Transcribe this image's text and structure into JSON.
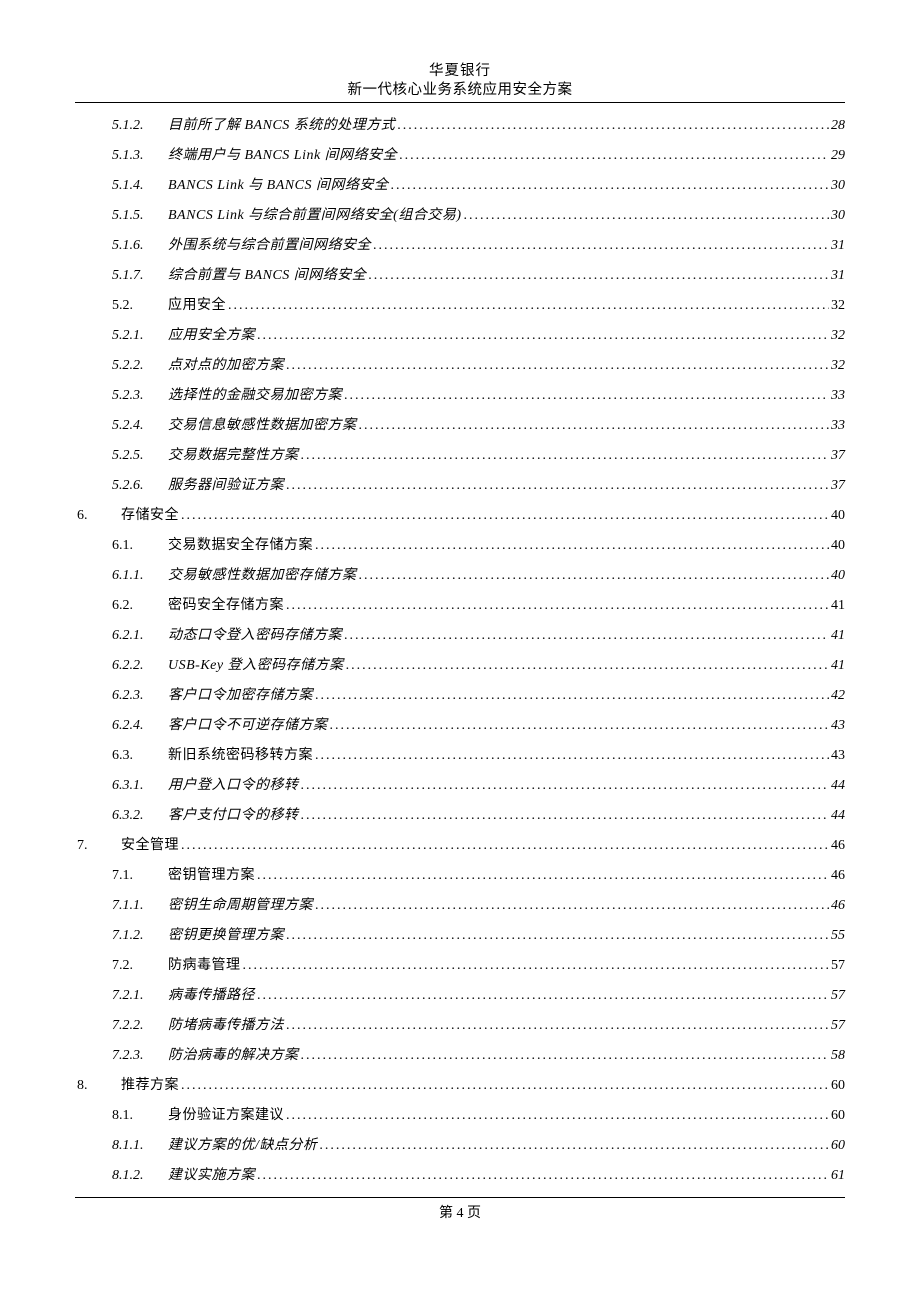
{
  "header": {
    "line1": "华夏银行",
    "line2": "新一代核心业务系统应用安全方案"
  },
  "toc": [
    {
      "level": "subsub",
      "num": "5.1.2.",
      "title": "目前所了解 BANCS 系统的处理方式",
      "page": "28"
    },
    {
      "level": "subsub",
      "num": "5.1.3.",
      "title": "终端用户与 BANCS Link 间网络安全",
      "page": "29"
    },
    {
      "level": "subsub",
      "num": "5.1.4.",
      "title": "BANCS Link 与 BANCS 间网络安全",
      "page": "30"
    },
    {
      "level": "subsub",
      "num": "5.1.5.",
      "title": "BANCS Link 与综合前置间网络安全(组合交易)",
      "page": "30"
    },
    {
      "level": "subsub",
      "num": "5.1.6.",
      "title": "外围系统与综合前置间网络安全",
      "page": "31"
    },
    {
      "level": "subsub",
      "num": "5.1.7.",
      "title": "综合前置与 BANCS 间网络安全",
      "page": "31"
    },
    {
      "level": "sub",
      "num": "5.2.",
      "title": "应用安全",
      "page": "32"
    },
    {
      "level": "subsub",
      "num": "5.2.1.",
      "title": "应用安全方案",
      "page": "32"
    },
    {
      "level": "subsub",
      "num": "5.2.2.",
      "title": "点对点的加密方案",
      "page": "32"
    },
    {
      "level": "subsub",
      "num": "5.2.3.",
      "title": "选择性的金融交易加密方案",
      "page": "33"
    },
    {
      "level": "subsub",
      "num": "5.2.4.",
      "title": "交易信息敏感性数据加密方案",
      "page": "33"
    },
    {
      "level": "subsub",
      "num": "5.2.5.",
      "title": "交易数据完整性方案",
      "page": "37"
    },
    {
      "level": "subsub",
      "num": "5.2.6.",
      "title": "服务器间验证方案",
      "page": "37"
    },
    {
      "level": "main",
      "num": "6.",
      "title": "存储安全",
      "page": "40"
    },
    {
      "level": "sub",
      "num": "6.1.",
      "title": "交易数据安全存储方案",
      "page": "40"
    },
    {
      "level": "subsub",
      "num": "6.1.1.",
      "title": "交易敏感性数据加密存储方案",
      "page": "40"
    },
    {
      "level": "sub",
      "num": "6.2.",
      "title": "密码安全存储方案",
      "page": "41"
    },
    {
      "level": "subsub",
      "num": "6.2.1.",
      "title": "动态口令登入密码存储方案",
      "page": "41"
    },
    {
      "level": "subsub",
      "num": "6.2.2.",
      "title": "USB-Key 登入密码存储方案",
      "page": "41"
    },
    {
      "level": "subsub",
      "num": "6.2.3.",
      "title": "客户口令加密存储方案",
      "page": "42"
    },
    {
      "level": "subsub",
      "num": "6.2.4.",
      "title": "客户口令不可逆存储方案",
      "page": "43"
    },
    {
      "level": "sub",
      "num": "6.3.",
      "title": "新旧系统密码移转方案",
      "page": "43"
    },
    {
      "level": "subsub",
      "num": "6.3.1.",
      "title": "用户登入口令的移转",
      "page": "44"
    },
    {
      "level": "subsub",
      "num": "6.3.2.",
      "title": "客户支付口令的移转",
      "page": "44"
    },
    {
      "level": "main",
      "num": "7.",
      "title": "安全管理",
      "page": "46"
    },
    {
      "level": "sub",
      "num": "7.1.",
      "title": "密钥管理方案",
      "page": "46"
    },
    {
      "level": "subsub",
      "num": "7.1.1.",
      "title": "密钥生命周期管理方案",
      "page": "46"
    },
    {
      "level": "subsub",
      "num": "7.1.2.",
      "title": "密钥更换管理方案",
      "page": "55"
    },
    {
      "level": "sub",
      "num": "7.2.",
      "title": "防病毒管理",
      "page": "57"
    },
    {
      "level": "subsub",
      "num": "7.2.1.",
      "title": "病毒传播路径",
      "page": "57"
    },
    {
      "level": "subsub",
      "num": "7.2.2.",
      "title": "防堵病毒传播方法",
      "page": "57"
    },
    {
      "level": "subsub",
      "num": "7.2.3.",
      "title": "防治病毒的解决方案",
      "page": "58"
    },
    {
      "level": "main",
      "num": "8.",
      "title": "推荐方案",
      "page": "60"
    },
    {
      "level": "sub",
      "num": "8.1.",
      "title": "身份验证方案建议",
      "page": "60"
    },
    {
      "level": "subsub",
      "num": "8.1.1.",
      "title": "建议方案的优/缺点分析",
      "page": "60"
    },
    {
      "level": "subsub",
      "num": "8.1.2.",
      "title": "建议实施方案",
      "page": "61"
    }
  ],
  "footer": {
    "page_label": "第 4 页"
  }
}
